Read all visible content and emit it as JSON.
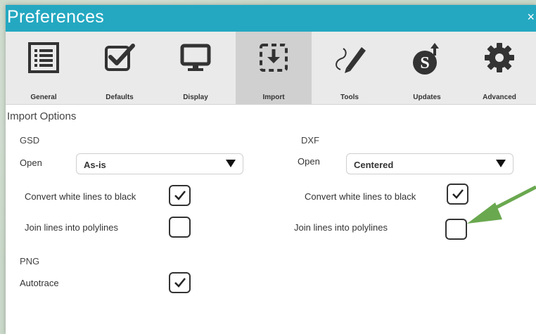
{
  "window": {
    "title": "Preferences",
    "close_glyph": "×"
  },
  "tabs": [
    {
      "label": "General",
      "icon": "list-icon",
      "active": false
    },
    {
      "label": "Defaults",
      "icon": "checkbox-icon",
      "active": false
    },
    {
      "label": "Display",
      "icon": "monitor-icon",
      "active": false
    },
    {
      "label": "Import",
      "icon": "import-icon",
      "active": true
    },
    {
      "label": "Tools",
      "icon": "pen-icon",
      "active": false
    },
    {
      "label": "Updates",
      "icon": "updates-icon",
      "active": false
    },
    {
      "label": "Advanced",
      "icon": "gear-icon",
      "active": false
    }
  ],
  "content": {
    "section_title": "Import Options",
    "gsd": {
      "title": "GSD",
      "open_label": "Open",
      "open_value": "As-is",
      "convert_label": "Convert white lines to black",
      "convert_checked": true,
      "join_label": "Join lines into polylines",
      "join_checked": false
    },
    "dxf": {
      "title": "DXF",
      "open_label": "Open",
      "open_value": "Centered",
      "convert_label": "Convert white lines to black",
      "convert_checked": true,
      "join_label": "Join lines into polylines",
      "join_checked": false
    },
    "png": {
      "title": "PNG",
      "autotrace_label": "Autotrace",
      "autotrace_checked": true
    }
  },
  "colors": {
    "titlebar": "#24a8c1",
    "annotation_arrow": "#6aa84f"
  }
}
